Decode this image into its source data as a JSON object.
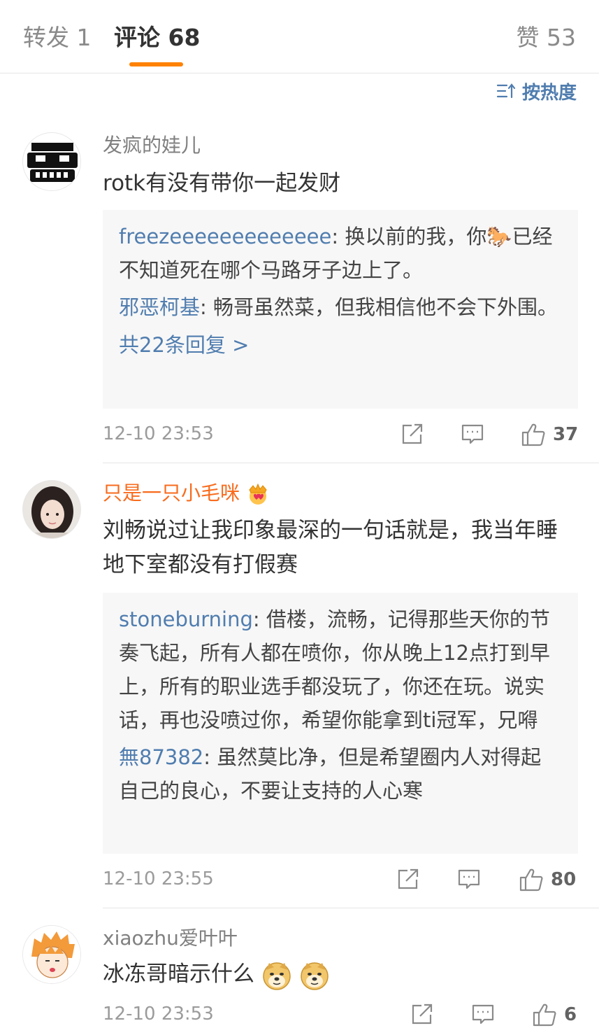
{
  "tabs": {
    "repost": "转发 1",
    "comments": "评论 68",
    "likes": "赞 53"
  },
  "sort": {
    "label": "按热度",
    "icon": "sort-icon"
  },
  "colors": {
    "accent": "#ff8200",
    "link": "#507daf",
    "vip_name": "#f86b1d"
  },
  "comments": [
    {
      "user": "发疯的娃儿",
      "text": "rotk有没有带你一起发财",
      "replies": [
        {
          "user": "freezeeeeeeeeeeeee",
          "text": "换以前的我，你🐎已经不知道死在哪个马路牙子边上了。"
        },
        {
          "user": "邪恶柯基",
          "text": "畅哥虽然菜，但我相信他不会下外围。"
        }
      ],
      "more_replies": "共22条回复 >",
      "time": "12-10 23:53",
      "likes": "37"
    },
    {
      "user": "只是一只小毛咪",
      "text": "刘畅说过让我印象最深的一句话就是，我当年睡地下室都没有打假赛",
      "replies": [
        {
          "user": "stoneburning",
          "text": "借楼，流畅，记得那些天你的节奏飞起，所有人都在喷你，你从晚上12点打到早上，所有的职业选手都没玩了，你还在玩。说实话，再也没喷过你，希望你能拿到ti冠军，兄嘚"
        },
        {
          "user": "無87382",
          "text": "虽然莫比净，但是希望圈内人对得起自己的良心，不要让支持的人心寒"
        }
      ],
      "time": "12-10 23:55",
      "likes": "80"
    },
    {
      "user": "xiaozhu爱叶叶",
      "text": "冰冻哥暗示什么",
      "time": "12-10 23:53",
      "likes": "6"
    }
  ]
}
